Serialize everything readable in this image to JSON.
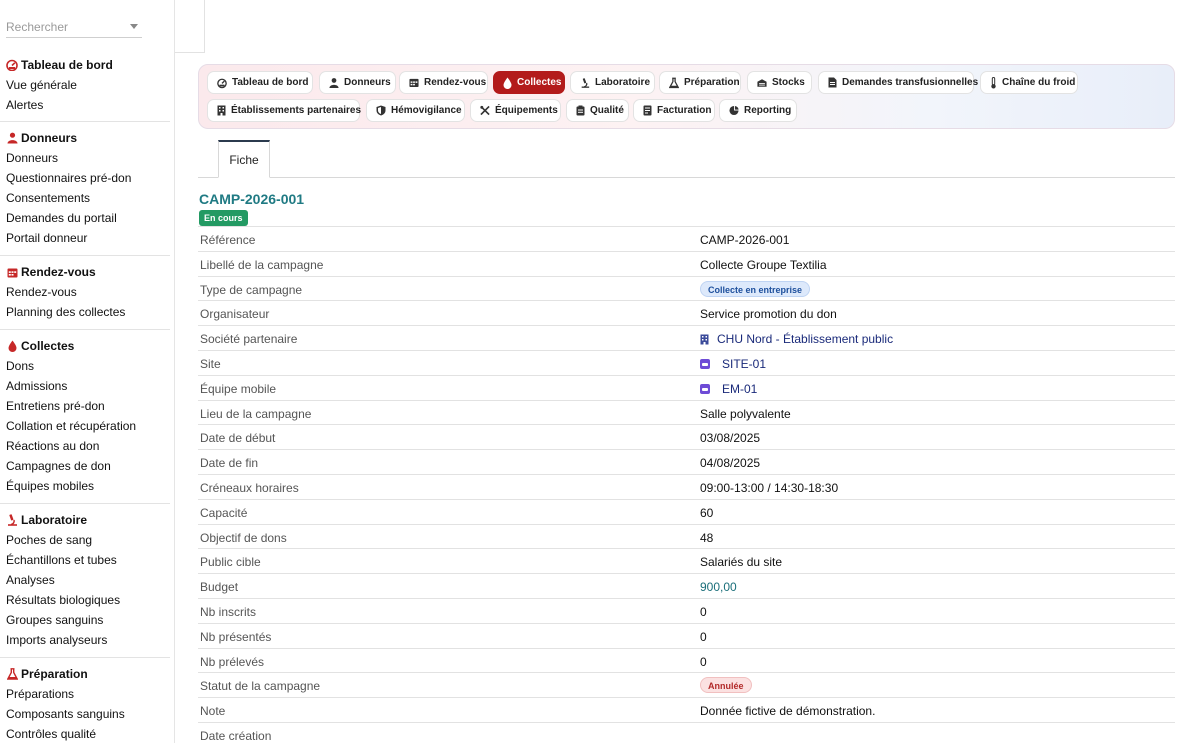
{
  "search": {
    "placeholder": "Rechercher"
  },
  "sidebar": {
    "sections": [
      {
        "title": "Tableau de bord",
        "icon": "dashboard-icon",
        "items": [
          "Vue générale",
          "Alertes"
        ]
      },
      {
        "title": "Donneurs",
        "icon": "user-icon",
        "items": [
          "Donneurs",
          "Questionnaires pré-don",
          "Consentements",
          "Demandes du portail",
          "Portail donneur"
        ]
      },
      {
        "title": "Rendez-vous",
        "icon": "calendar-icon",
        "items": [
          "Rendez-vous",
          "Planning des collectes"
        ]
      },
      {
        "title": "Collectes",
        "icon": "blood-drop-icon",
        "items": [
          "Dons",
          "Admissions",
          "Entretiens pré-don",
          "Collation et récupération",
          "Réactions au don",
          "Campagnes de don",
          "Équipes mobiles"
        ]
      },
      {
        "title": "Laboratoire",
        "icon": "microscope-icon",
        "items": [
          "Poches de sang",
          "Échantillons et tubes",
          "Analyses",
          "Résultats biologiques",
          "Groupes sanguins",
          "Imports analyseurs"
        ]
      },
      {
        "title": "Préparation",
        "icon": "flask-icon",
        "items": [
          "Préparations",
          "Composants sanguins",
          "Contrôles qualité"
        ]
      }
    ]
  },
  "modules": [
    {
      "label": "Tableau de bord",
      "icon": "dashboard-icon"
    },
    {
      "label": "Donneurs",
      "icon": "user-icon"
    },
    {
      "label": "Rendez-vous",
      "icon": "calendar-icon"
    },
    {
      "label": "Collectes",
      "icon": "blood-drop-icon",
      "active": true
    },
    {
      "label": "Laboratoire",
      "icon": "microscope-icon"
    },
    {
      "label": "Préparation",
      "icon": "flask-icon"
    },
    {
      "label": "Stocks",
      "icon": "warehouse-icon"
    },
    {
      "label": "Demandes transfusionnelles",
      "icon": "document-icon"
    },
    {
      "label": "Chaîne du froid",
      "icon": "thermometer-icon"
    },
    {
      "label": "Établissements partenaires",
      "icon": "building-icon"
    },
    {
      "label": "Hémovigilance",
      "icon": "shield-icon"
    },
    {
      "label": "Équipements",
      "icon": "tools-icon"
    },
    {
      "label": "Qualité",
      "icon": "clipboard-icon"
    },
    {
      "label": "Facturation",
      "icon": "invoice-icon"
    },
    {
      "label": "Reporting",
      "icon": "chart-icon"
    }
  ],
  "subtabs": {
    "fiche": "Fiche"
  },
  "record": {
    "id": "CAMP-2026-001",
    "status": "En cours",
    "colors": {
      "accent": "#b31b1b",
      "title": "#1f7a83",
      "status_green": "#239a63"
    },
    "fields": [
      {
        "label": "Référence",
        "value": "CAMP-2026-001"
      },
      {
        "label": "Libellé de la campagne",
        "value": "Collecte Groupe Textilia"
      },
      {
        "label": "Type de campagne",
        "value": "Collecte en entreprise",
        "kind": "pill-blue"
      },
      {
        "label": "Organisateur",
        "value": "Service promotion du don"
      },
      {
        "label": "Société partenaire",
        "value": "CHU Nord - Établissement public",
        "kind": "link-building"
      },
      {
        "label": "Site",
        "value": "SITE-01",
        "kind": "link-square"
      },
      {
        "label": "Équipe mobile",
        "value": "EM-01",
        "kind": "link-square"
      },
      {
        "label": "Lieu de la campagne",
        "value": "Salle polyvalente"
      },
      {
        "label": "Date de début",
        "value": "03/08/2025"
      },
      {
        "label": "Date de fin",
        "value": "04/08/2025"
      },
      {
        "label": "Créneaux horaires",
        "value": "09:00-13:00 / 14:30-18:30"
      },
      {
        "label": "Capacité",
        "value": "60"
      },
      {
        "label": "Objectif de dons",
        "value": "48"
      },
      {
        "label": "Public cible",
        "value": "Salariés du site"
      },
      {
        "label": "Budget",
        "value": "900,00",
        "kind": "money"
      },
      {
        "label": "Nb inscrits",
        "value": "0"
      },
      {
        "label": "Nb présentés",
        "value": "0"
      },
      {
        "label": "Nb prélevés",
        "value": "0"
      },
      {
        "label": "Statut de la campagne",
        "value": "Annulée",
        "kind": "pill-red"
      },
      {
        "label": "Note",
        "value": "Donnée fictive de démonstration."
      },
      {
        "label": "Date création",
        "value": ""
      }
    ]
  }
}
